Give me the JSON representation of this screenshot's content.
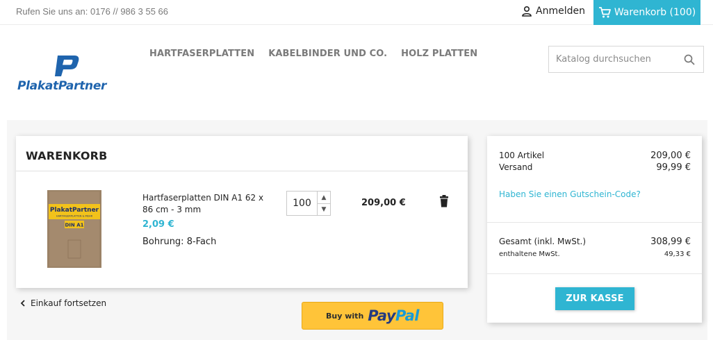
{
  "topbar": {
    "phone": "Rufen Sie uns an: 0176 // 986 3 55 66",
    "signin_label": "Anmelden",
    "signin_icon": "user-icon",
    "cart_label": "Warenkorb (100)",
    "cart_icon": "cart-icon"
  },
  "header": {
    "logo_text": "PlakatPartner",
    "nav": [
      "HARTFASERPLATTEN",
      "KABELBINDER UND CO.",
      "HOLZ PLATTEN"
    ],
    "search_placeholder": "Katalog durchsuchen",
    "search_icon": "search-icon"
  },
  "cart": {
    "title": "WARENKORB",
    "item": {
      "name": "Hartfaserplatten DIN A1 62 x 86 cm - 3 mm",
      "unit_price": "2,09 €",
      "attribute_label": "Bohrung:",
      "attribute_value": "8-Fach",
      "quantity": "100",
      "total": "209,00 €",
      "image_text": {
        "brand": "PlakatPartner",
        "tagline": "HARTFASERPLATTEN & MEHR",
        "size": "DIN A1"
      }
    },
    "continue_label": "Einkauf fortsetzen",
    "paypal_prefix": "Buy with",
    "paypal_brand_1": "Pay",
    "paypal_brand_2": "Pal"
  },
  "summary": {
    "items_label": "100 Artikel",
    "items_value": "209,00 €",
    "shipping_label": "Versand",
    "shipping_value": "99,99 €",
    "voucher_link": "Haben Sie einen Gutschein-Code?",
    "total_label": "Gesamt (inkl. MwSt.)",
    "total_value": "308,99 €",
    "tax_label": "enthaltene MwSt.",
    "tax_value": "49,33 €",
    "checkout_label": "ZUR KASSE"
  },
  "colors": {
    "accent": "#2fb5d2",
    "logo_blue": "#1f64ad",
    "paypal_yellow": "#ffc439"
  }
}
